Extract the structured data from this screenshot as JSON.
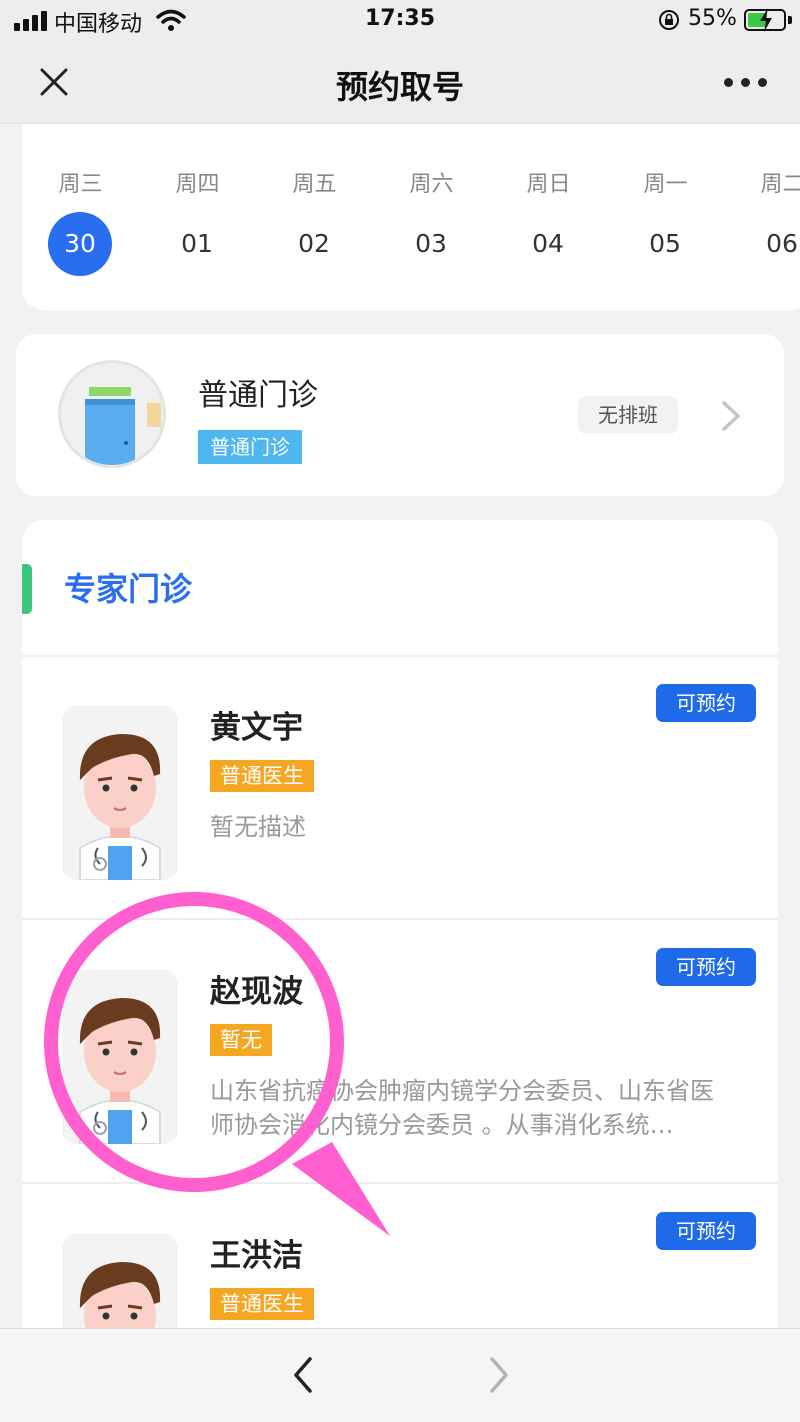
{
  "status_bar": {
    "carrier": "中国移动",
    "time": "17:35",
    "battery_percent": "55%",
    "battery_level": 0.55
  },
  "nav": {
    "title": "预约取号",
    "close_icon": "close-icon",
    "more_icon": "more-icon"
  },
  "dates": [
    {
      "weekday": "周三",
      "day": "30",
      "selected": true
    },
    {
      "weekday": "周四",
      "day": "01",
      "selected": false
    },
    {
      "weekday": "周五",
      "day": "02",
      "selected": false
    },
    {
      "weekday": "周六",
      "day": "03",
      "selected": false
    },
    {
      "weekday": "周日",
      "day": "04",
      "selected": false
    },
    {
      "weekday": "周一",
      "day": "05",
      "selected": false
    },
    {
      "weekday": "周二",
      "day": "06",
      "selected": false
    }
  ],
  "general_clinic": {
    "name": "普通门诊",
    "tag": "普通门诊",
    "status": "无排班"
  },
  "expert_section": {
    "title": "专家门诊",
    "doctors": [
      {
        "name": "黄文宇",
        "level": "普通医生",
        "desc": "暂无描述",
        "button": "可预约"
      },
      {
        "name": "赵现波",
        "level": "暂无",
        "desc": "山东省抗癌协会肿瘤内镜学分会委员、山东省医师协会消化内镜分会委员 。从事消化系统…",
        "button": "可预约"
      },
      {
        "name": "王洪洁",
        "level": "普通医生",
        "desc": "",
        "button": "可预约"
      }
    ]
  },
  "colors": {
    "accent": "#2a6ef0",
    "button": "#1f6ae8",
    "tag_orange": "#f5a623",
    "tag_blue": "#4fb7f0",
    "section_bar": "#3cc67b",
    "annotation": "#ff5fcf"
  }
}
